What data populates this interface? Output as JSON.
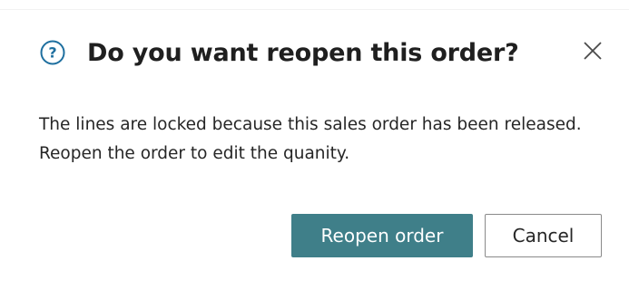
{
  "dialog": {
    "title": "Do you want reopen this order?",
    "message_lines": [
      "The lines are locked because this sales order has been released.",
      "Reopen the order to edit the quanity."
    ],
    "icons": {
      "header": "question-circle-icon",
      "close": "close-icon"
    },
    "buttons": {
      "primary_label": "Reopen order",
      "secondary_label": "Cancel"
    },
    "colors": {
      "accent": "#3f7f89",
      "icon_blue": "#1e6f9f"
    }
  }
}
